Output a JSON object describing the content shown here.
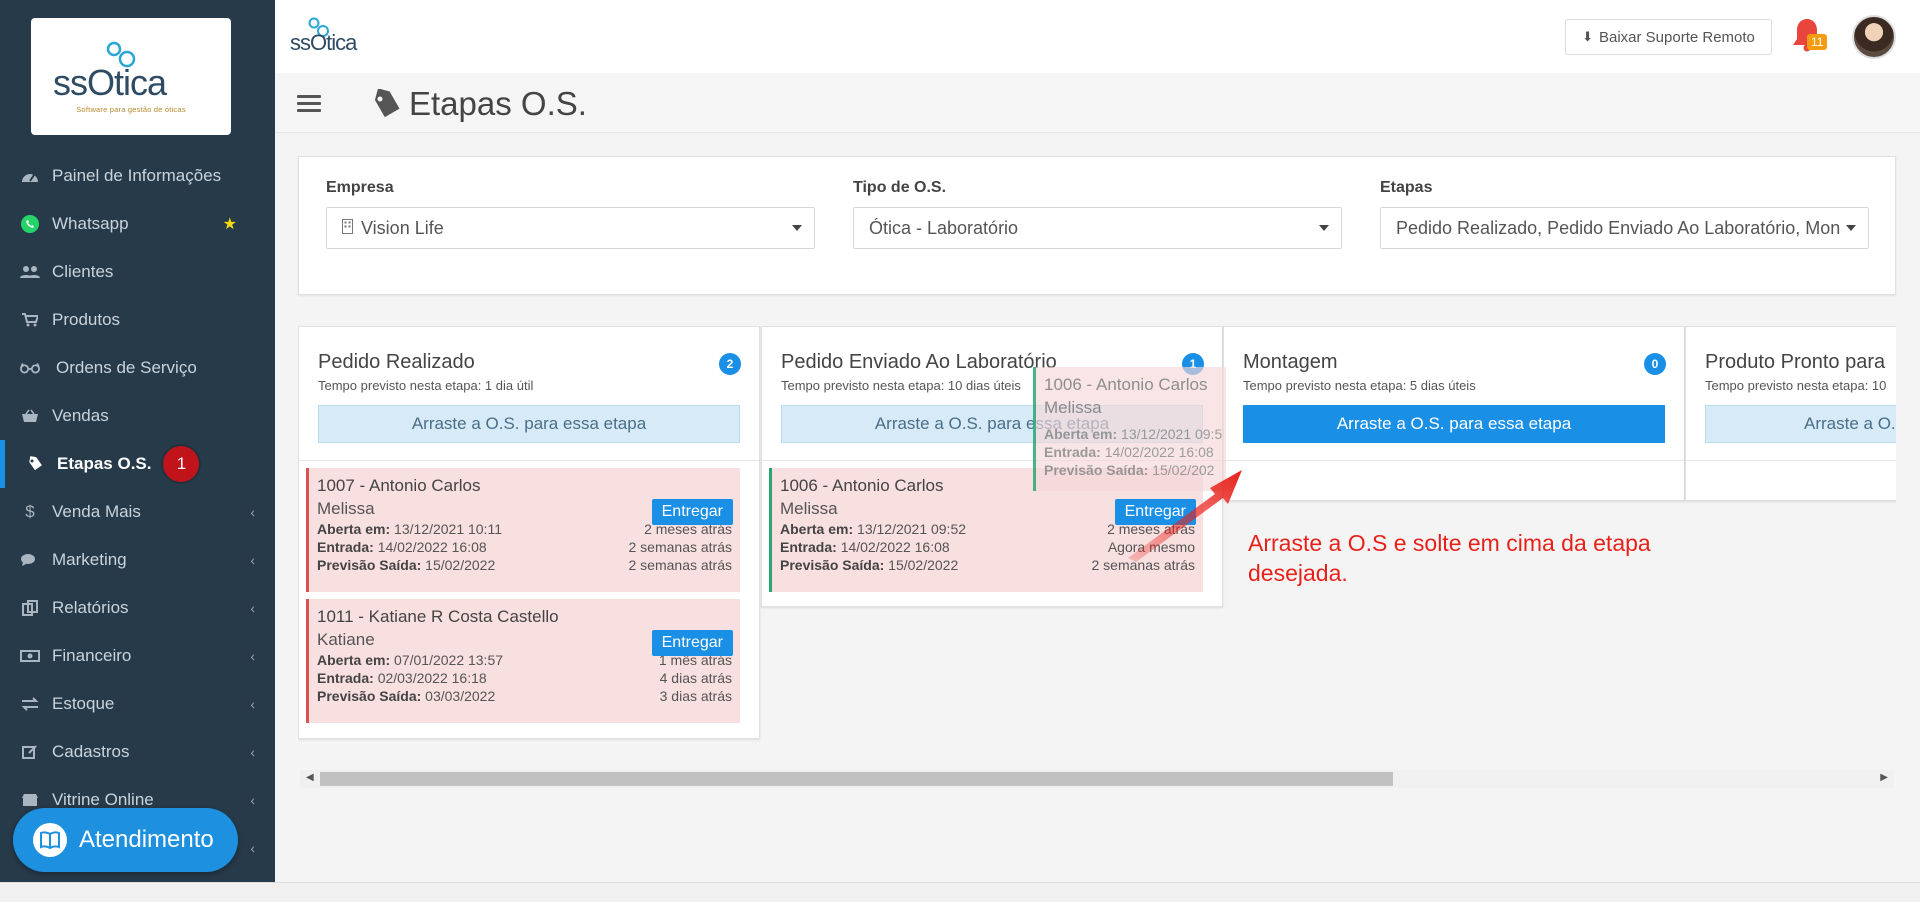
{
  "app": {
    "logo_text": "ssOtica",
    "logo_tagline": "Software para gestão de óticas"
  },
  "sidebar": {
    "items": [
      {
        "label": "Painel de Informações",
        "icon": "dashboard-icon"
      },
      {
        "label": "Whatsapp",
        "icon": "whatsapp-icon"
      },
      {
        "label": "Clientes",
        "icon": "users-icon"
      },
      {
        "label": "Produtos",
        "icon": "cart-icon"
      },
      {
        "label": "Ordens de Serviço",
        "icon": "glasses-icon"
      },
      {
        "label": "Vendas",
        "icon": "basket-icon"
      },
      {
        "label": "Etapas O.S.",
        "icon": "tag-icon",
        "badge": "1"
      },
      {
        "label": "Venda Mais",
        "icon": "dollar-icon"
      },
      {
        "label": "Marketing",
        "icon": "comments-icon"
      },
      {
        "label": "Relatórios",
        "icon": "copy-icon"
      },
      {
        "label": "Financeiro",
        "icon": "money-icon"
      },
      {
        "label": "Estoque",
        "icon": "exchange-icon"
      },
      {
        "label": "Cadastros",
        "icon": "edit-icon"
      },
      {
        "label": "Vitrine Online",
        "icon": "store-icon"
      }
    ],
    "atendimento_label": "Atendimento"
  },
  "topbar": {
    "suporte_label": "Baixar Suporte Remoto",
    "notifications_count": "11"
  },
  "header": {
    "title": "Etapas O.S."
  },
  "filters": {
    "empresa_label": "Empresa",
    "empresa_value": "Vision Life",
    "tipo_label": "Tipo de O.S.",
    "tipo_value": "Ótica - Laboratório",
    "etapas_label": "Etapas",
    "etapas_value": "Pedido Realizado, Pedido Enviado Ao Laboratório, Mon"
  },
  "board": {
    "columns": [
      {
        "title": "Pedido Realizado",
        "count": "2",
        "subtitle": "Tempo previsto nesta etapa: 1 dia útil",
        "dropzone": "Arraste a O.S. para essa etapa",
        "cards": [
          {
            "title": "1007 - Antonio Carlos",
            "name": "Melissa",
            "button": "Entregar",
            "aberta_label": "Aberta em:",
            "aberta": "13/12/2021 10:11",
            "aberta_rel": "2 meses atrás",
            "entrada_label": "Entrada:",
            "entrada": "14/02/2022 16:08",
            "entrada_rel": "2 semanas atrás",
            "previsao_label": "Previsão Saída:",
            "previsao": "15/02/2022",
            "previsao_rel": "2 semanas atrás"
          },
          {
            "title": "1011 - Katiane R Costa Castello",
            "name": "Katiane",
            "button": "Entregar",
            "aberta_label": "Aberta em:",
            "aberta": "07/01/2022 13:57",
            "aberta_rel": "1 mês atrás",
            "entrada_label": "Entrada:",
            "entrada": "02/03/2022 16:18",
            "entrada_rel": "4 dias atrás",
            "previsao_label": "Previsão Saída:",
            "previsao": "03/03/2022",
            "previsao_rel": "3 dias atrás"
          }
        ]
      },
      {
        "title": "Pedido Enviado Ao Laboratório",
        "count": "1",
        "subtitle": "Tempo previsto nesta etapa: 10 dias úteis",
        "dropzone": "Arraste a O.S. para essa etapa",
        "cards": [
          {
            "title": "1006 - Antonio Carlos",
            "name": "Melissa",
            "button": "Entregar",
            "aberta_label": "Aberta em:",
            "aberta": "13/12/2021 09:52",
            "aberta_rel": "2 meses atrás",
            "entrada_label": "Entrada:",
            "entrada": "14/02/2022 16:08",
            "entrada_rel": "Agora mesmo",
            "previsao_label": "Previsão Saída:",
            "previsao": "15/02/2022",
            "previsao_rel": "2 semanas atrás"
          }
        ]
      },
      {
        "title": "Montagem",
        "count": "0",
        "subtitle": "Tempo previsto nesta etapa: 5 dias úteis",
        "dropzone": "Arraste a O.S. para essa etapa"
      },
      {
        "title": "Produto Pronto para",
        "subtitle": "Tempo previsto nesta etapa: 10",
        "dropzone": "Arraste a O.S."
      }
    ]
  },
  "ghost_card": {
    "title": "1006 - Antonio Carlos",
    "name": "Melissa",
    "aberta_label": "Aberta em:",
    "aberta": "13/12/2021 09:5",
    "entrada_label": "Entrada:",
    "entrada": "14/02/2022 16:08",
    "previsao_label": "Previsão Saída:",
    "previsao": "15/02/202"
  },
  "annotation": {
    "line1": "Arraste a O.S e solte em cima da etapa",
    "line2": "desejada."
  },
  "colors": {
    "sidebar_bg": "#263a4a",
    "accent": "#1a8fe6",
    "card_bg": "#f8dfe0",
    "annotation": "#e8201a"
  }
}
